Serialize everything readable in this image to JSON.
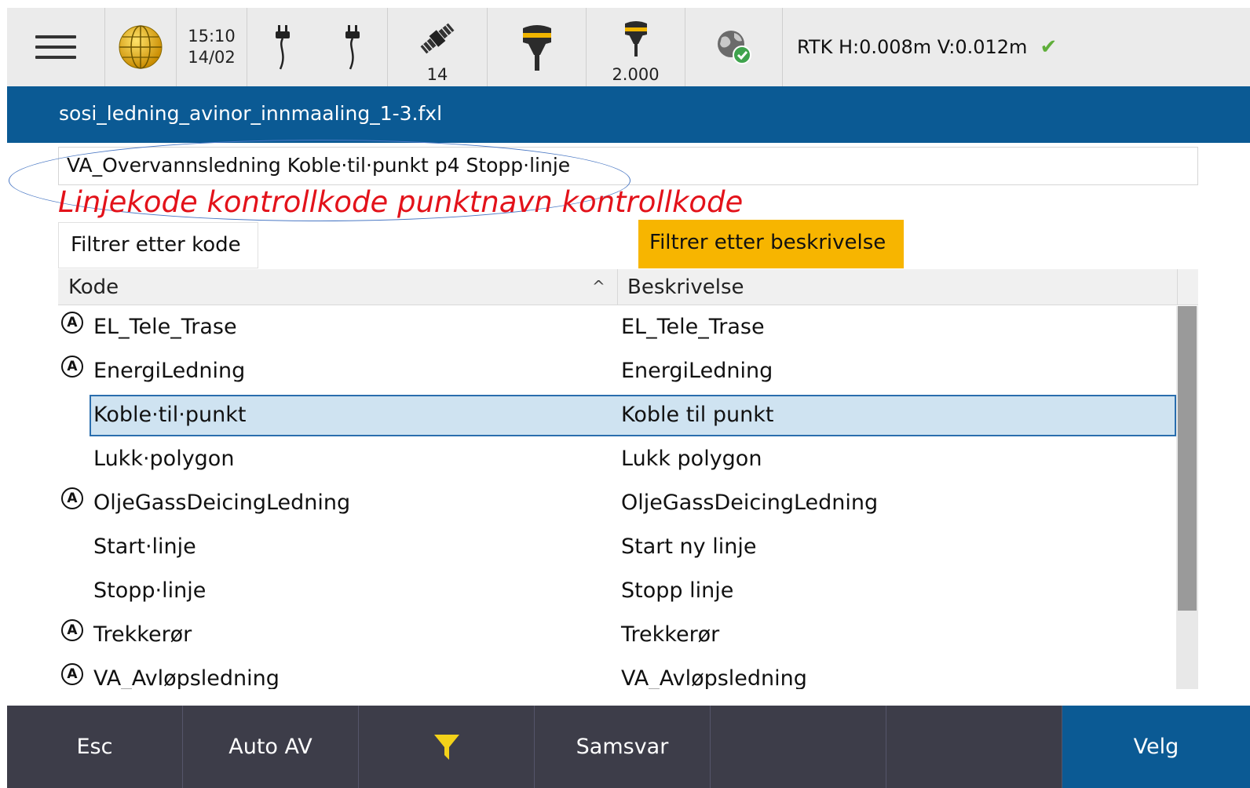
{
  "statusbar": {
    "time": "15:10",
    "date": "14/02",
    "satellites": "14",
    "antenna_height": "2.000",
    "rtk_status": "RTK H:0.008m V:0.012m"
  },
  "title": "sosi_ledning_avinor_innmaaling_1-3.fxl",
  "code_input": {
    "value": "VA_Overvannsledning Koble·til·punkt p4 Stopp·linje"
  },
  "annotation": "Linjekode kontrollkode punktnavn kontrollkode",
  "filters": {
    "by_code": "Filtrer etter kode",
    "by_description": "Filtrer etter beskrivelse"
  },
  "table": {
    "headers": {
      "code": "Kode",
      "description": "Beskrivelse"
    },
    "rows": [
      {
        "icon": "Ⓐ",
        "code": "EL_Tele_Trase",
        "description": "EL_Tele_Trase"
      },
      {
        "icon": "Ⓐ",
        "code": "EnergiLedning",
        "description": "EnergiLedning"
      },
      {
        "icon": "",
        "code": "Koble·til·punkt",
        "description": "Koble til punkt"
      },
      {
        "icon": "",
        "code": "Lukk·polygon",
        "description": "Lukk polygon"
      },
      {
        "icon": "Ⓐ",
        "code": "OljeGassDeicingLedning",
        "description": "OljeGassDeicingLedning"
      },
      {
        "icon": "",
        "code": "Start·linje",
        "description": "Start ny linje"
      },
      {
        "icon": "",
        "code": "Stopp·linje",
        "description": "Stopp linje"
      },
      {
        "icon": "Ⓐ",
        "code": "Trekkerør",
        "description": "Trekkerør"
      },
      {
        "icon": "Ⓐ",
        "code": "VA_Avløpsledning",
        "description": "VA_Avløpsledning"
      }
    ]
  },
  "toolbar": {
    "esc": "Esc",
    "auto_off": "Auto AV",
    "match": "Samsvar",
    "select": "Velg"
  },
  "colors": {
    "title_bar": "#0b5a94",
    "filter_active": "#f7b500",
    "selection": "#cfe3f1",
    "annotation": "#e3121a",
    "toolbar": "#3d3d49"
  }
}
